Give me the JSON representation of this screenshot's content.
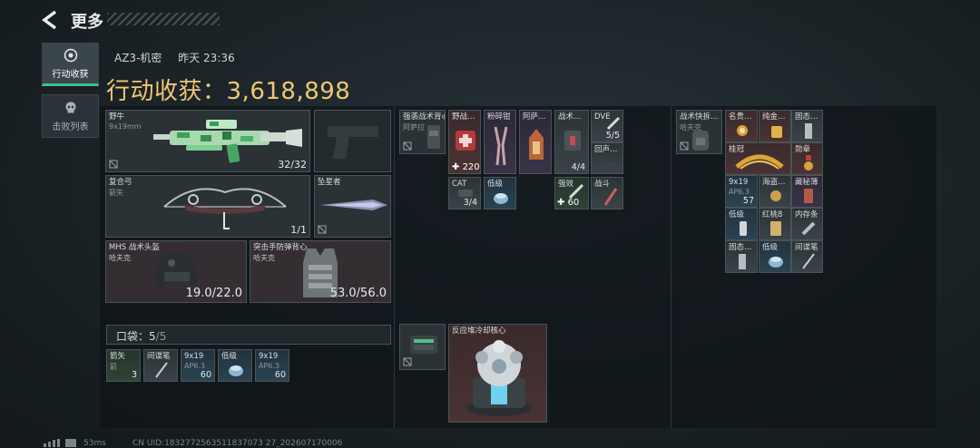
{
  "header": {
    "title": "更多"
  },
  "tabs": [
    {
      "label": "行动收获",
      "icon": "target-icon",
      "active": true
    },
    {
      "label": "击败列表",
      "icon": "skull-icon",
      "active": false
    }
  ],
  "raid": {
    "map": "AZ3-机密",
    "time": "昨天 23:36",
    "loot_label": "行动收获：",
    "loot_value": "3,618,898"
  },
  "weapons": {
    "primary": {
      "name": "野牛",
      "caliber": "9x19mm",
      "ammo": "32/32"
    },
    "bow": {
      "name": "复合弓",
      "ammo_type": "箭矢",
      "ammo": "1/1"
    },
    "melee": {
      "name": "坠星者"
    }
  },
  "armor": {
    "helmet": {
      "name": "MHS 战术头盔",
      "brand": "哈夫克",
      "durability": "19.0/22.0"
    },
    "vest": {
      "name": "突击手防弹背心",
      "brand": "哈夫克",
      "durability": "53.0/56.0"
    }
  },
  "pocket": {
    "label": "口袋：",
    "count": "5",
    "capacity": "/5",
    "items": [
      {
        "name": "箭矢",
        "sub": "箭",
        "count": "3",
        "tier": "green"
      },
      {
        "name": "间谍笔",
        "sub": "",
        "count": "",
        "tier": "gray"
      },
      {
        "name": "9x19",
        "sub": "AP6.3",
        "count": "60",
        "tier": "blue"
      },
      {
        "name": "低级",
        "sub": "",
        "count": "",
        "tier": "blue"
      },
      {
        "name": "9x19",
        "sub": "AP6.3",
        "count": "60",
        "tier": "blue"
      }
    ]
  },
  "rig": {
    "name": "强袭战术背心",
    "brand": "阿萨拉"
  },
  "rig_items": [
    {
      "name": "野战…",
      "count": "220",
      "plus": true,
      "tier": "red"
    },
    {
      "name": "粉碎钳",
      "count": "",
      "tier": "purple"
    },
    {
      "name": "阿萨…",
      "count": "",
      "tier": "purple"
    },
    {
      "name": "战术…",
      "count": "4/4",
      "tier": "gray"
    },
    {
      "name": "DVE",
      "count": "5/5",
      "tier": "gray"
    },
    {
      "name": "回声…",
      "count": "",
      "tier": "gray"
    },
    {
      "name": "CAT",
      "count": "3/4",
      "tier": "gray"
    },
    {
      "name": "低级",
      "count": "",
      "tier": "blue"
    },
    {
      "name": "强效",
      "count": "60",
      "plus": true,
      "tier": "green"
    },
    {
      "name": "战斗",
      "count": "",
      "tier": "gray"
    }
  ],
  "backpack": {
    "name": "战术快拆…",
    "brand": "哈夫克"
  },
  "backpack_items": [
    {
      "name": "名贵…",
      "count": "",
      "tier": "red"
    },
    {
      "name": "纯金…",
      "count": "",
      "tier": "red"
    },
    {
      "name": "固态…",
      "count": "",
      "tier": "gray"
    },
    {
      "name": "桂冠",
      "count": "",
      "tier": "red"
    },
    {
      "name": "勋章",
      "count": "",
      "tier": "red"
    },
    {
      "name": "9x19",
      "sub": "AP6.3",
      "count": "57",
      "tier": "blue"
    },
    {
      "name": "海盗…",
      "count": "",
      "tier": "gray"
    },
    {
      "name": "藏秘簿",
      "count": "",
      "tier": "purple"
    },
    {
      "name": "低级",
      "count": "",
      "tier": "blue"
    },
    {
      "name": "红桃8",
      "count": "",
      "tier": "gray"
    },
    {
      "name": "内存条",
      "count": "",
      "tier": "gray"
    },
    {
      "name": "固态…",
      "count": "",
      "tier": "gray"
    },
    {
      "name": "低级",
      "count": "",
      "tier": "blue"
    },
    {
      "name": "间谍笔",
      "count": "",
      "tier": "gray"
    }
  ],
  "safe_box": {
    "name": ""
  },
  "special": {
    "name": "反应堆冷却核心"
  },
  "footer": {
    "ping": "53ms",
    "uid": "CN UID:1832772563511837073 27_202607170006"
  }
}
